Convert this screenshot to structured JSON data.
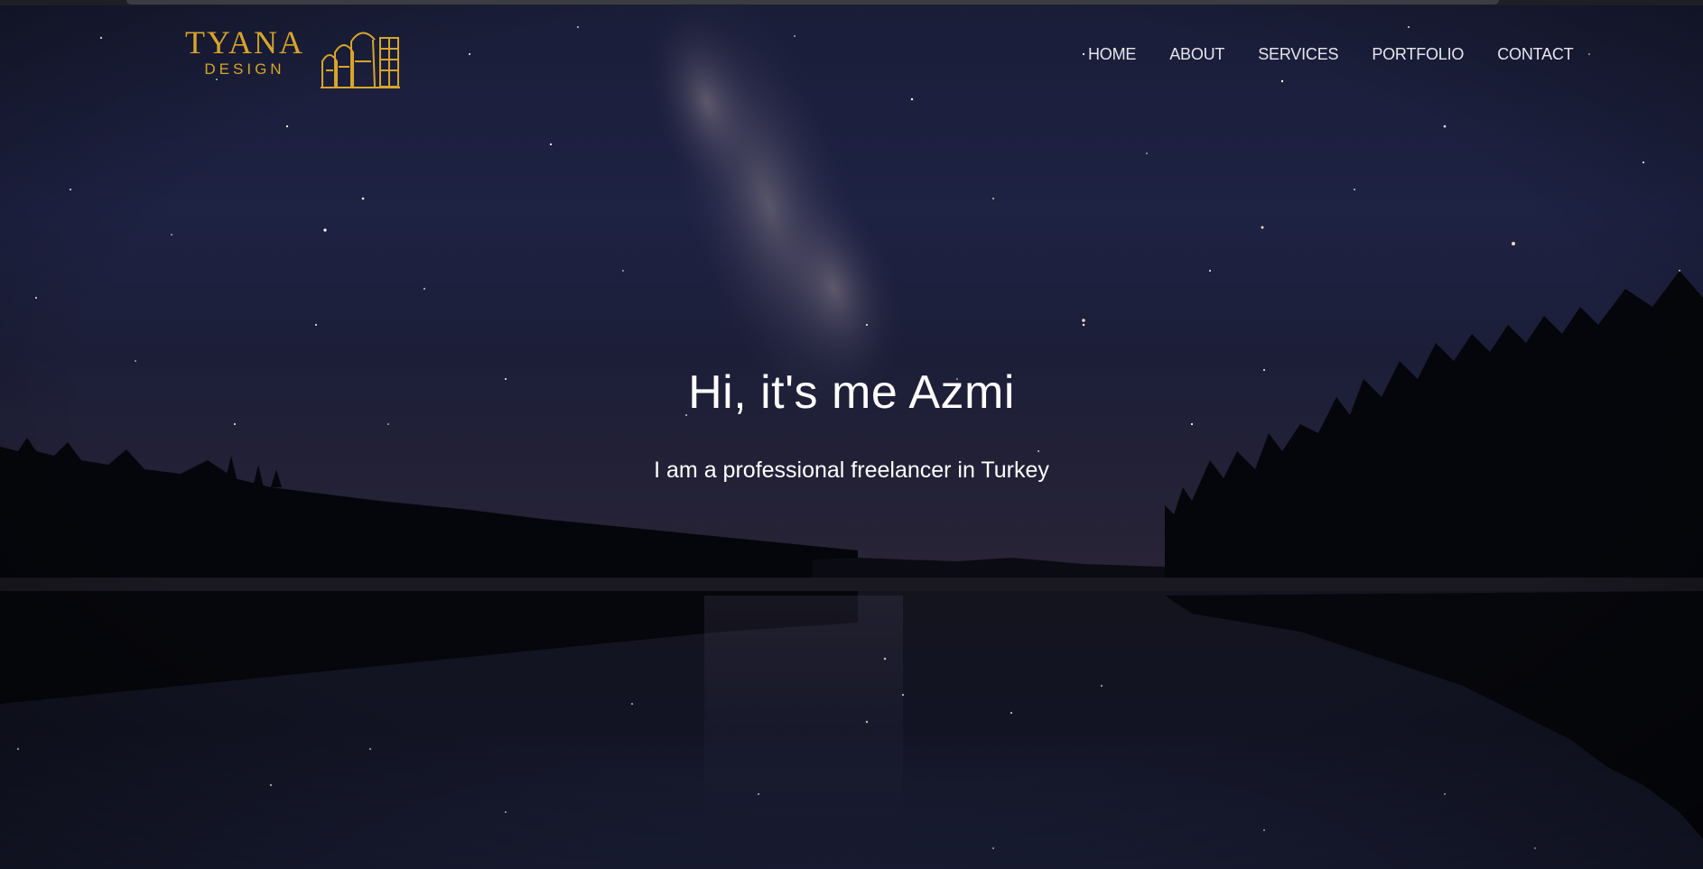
{
  "logo": {
    "title": "TYANA",
    "subtitle": "DESIGN",
    "icon": "arches-icon",
    "color": "#d7a52a"
  },
  "nav": {
    "items": [
      {
        "label": "HOME"
      },
      {
        "label": "ABOUT"
      },
      {
        "label": "SERVICES"
      },
      {
        "label": "PORTFOLIO"
      },
      {
        "label": "CONTACT"
      }
    ]
  },
  "hero": {
    "title": "Hi, it's me Azmi",
    "subtitle": "I am a professional freelancer in Turkey",
    "background": "night sky with milky way over a lake reflecting forest silhouette"
  }
}
